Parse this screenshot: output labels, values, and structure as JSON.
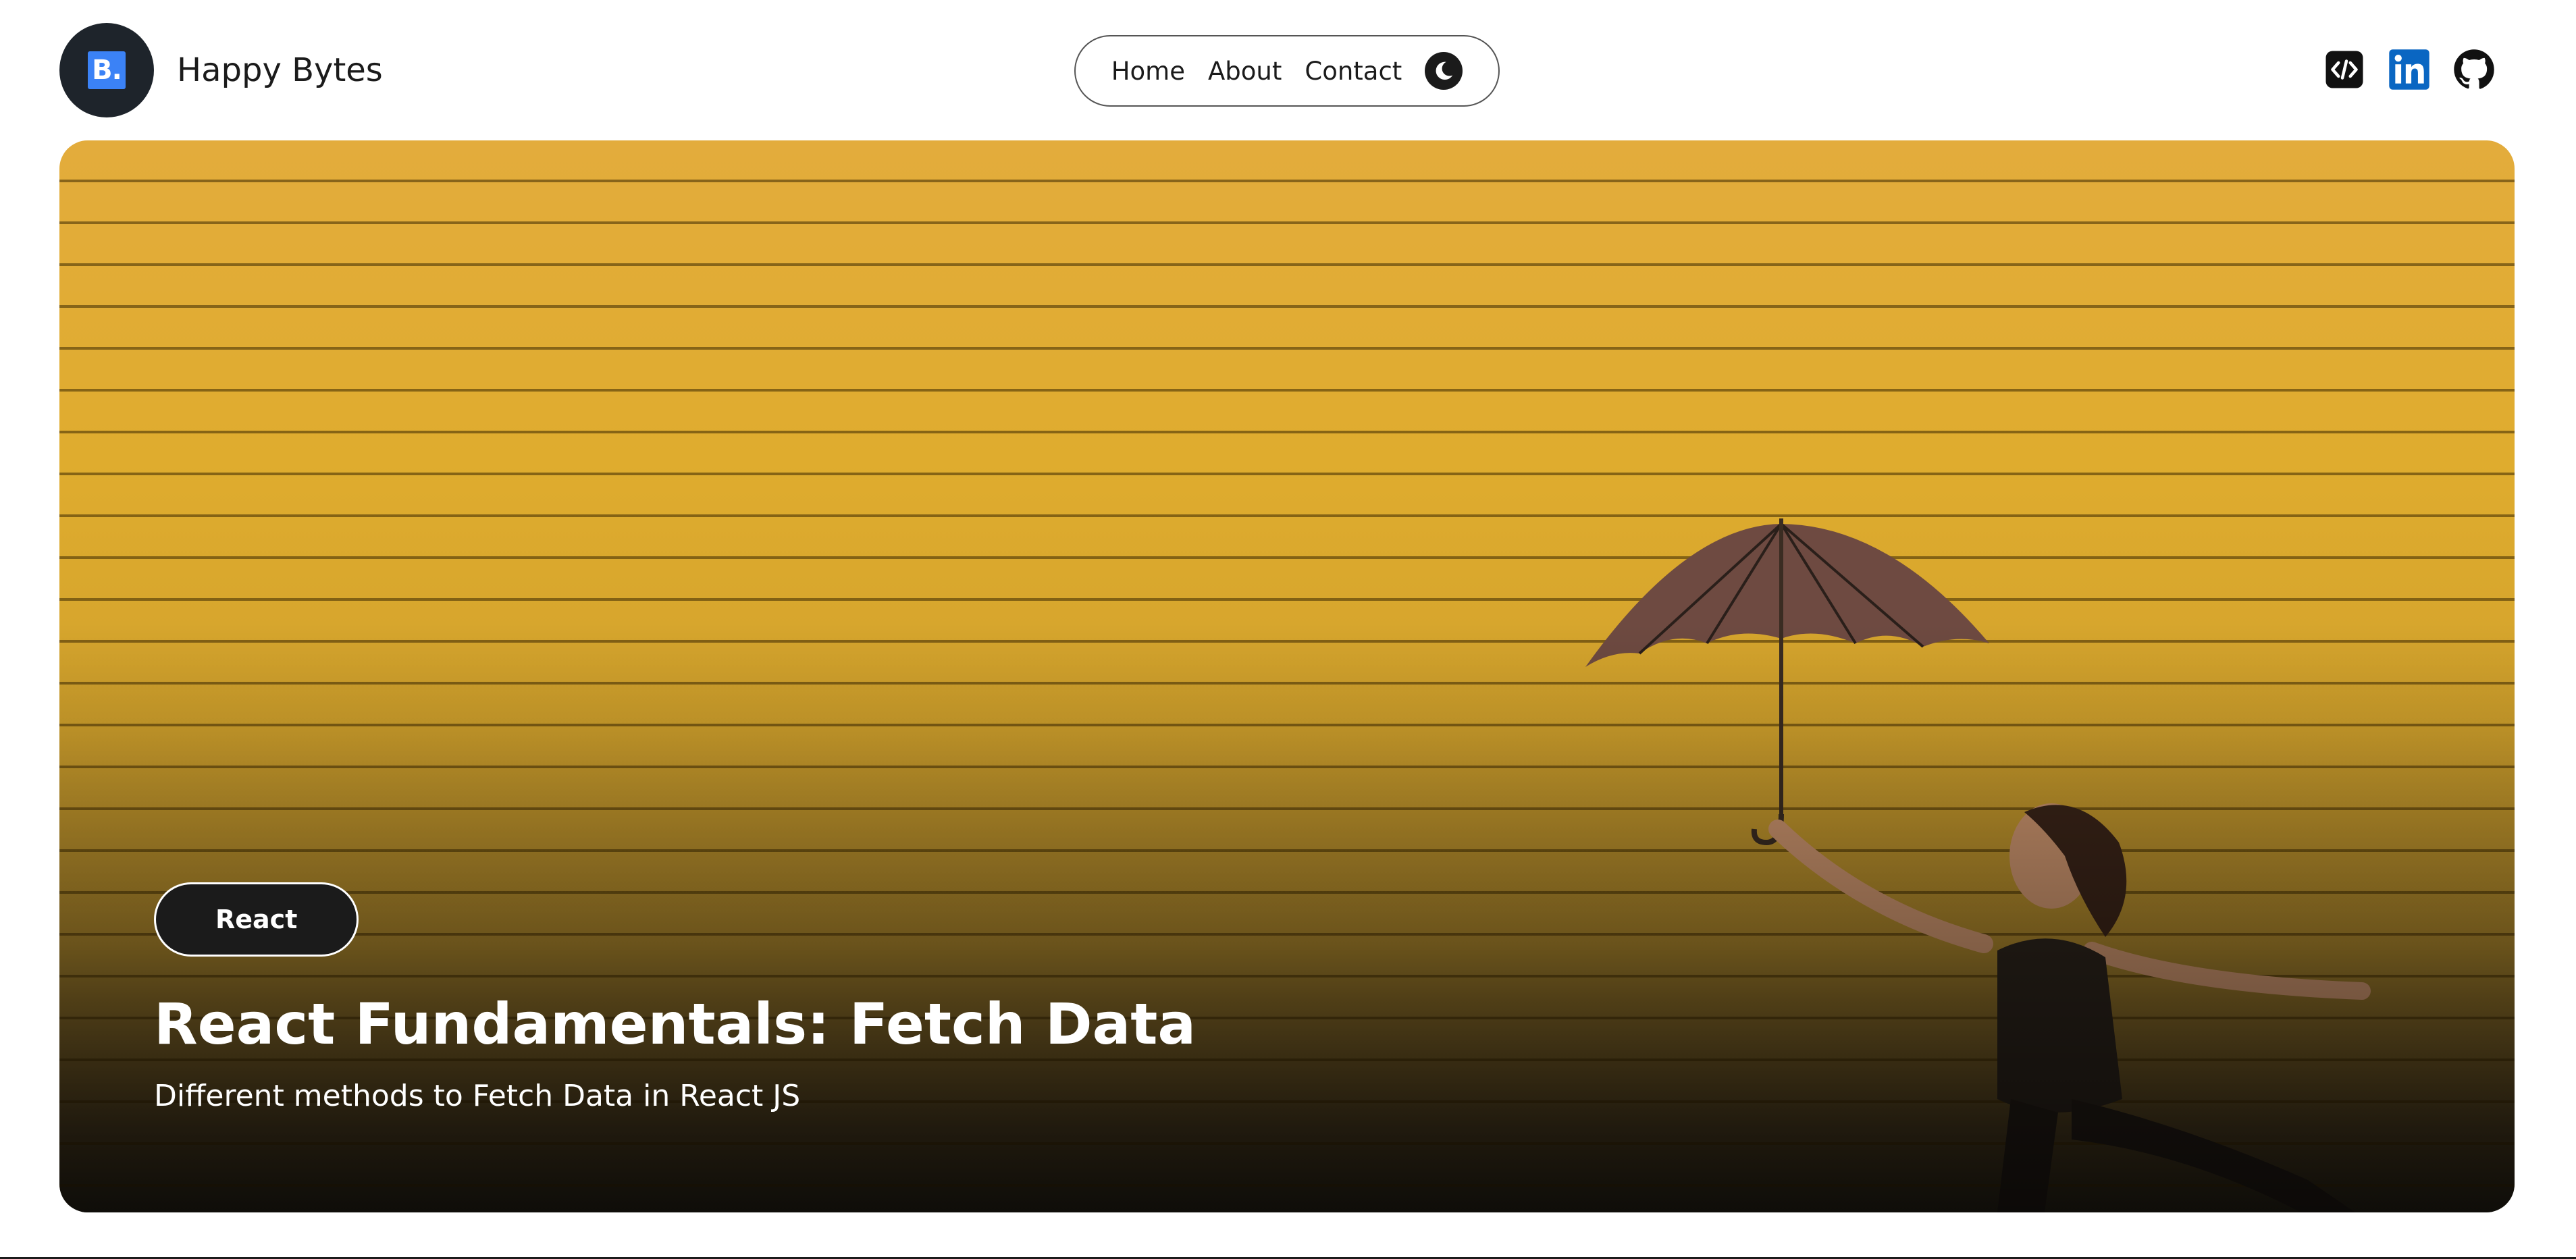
{
  "header": {
    "brand": {
      "logo_text": "B.",
      "name": "Happy Bytes"
    },
    "nav": {
      "items": [
        {
          "label": "Home"
        },
        {
          "label": "About"
        },
        {
          "label": "Contact"
        }
      ],
      "theme_toggle_icon": "moon-icon"
    },
    "socials": [
      {
        "icon": "code-icon"
      },
      {
        "icon": "linkedin-icon"
      },
      {
        "icon": "github-icon"
      }
    ]
  },
  "hero": {
    "tag": "React",
    "title": "React Fundamentals: Fetch Data",
    "subtitle": "Different methods to Fetch Data in React JS",
    "image_colors": {
      "wall": "#dfac2e",
      "umbrella": "#6e4a41",
      "figure": "#2b231b"
    }
  },
  "colors": {
    "dark": "#1b1b1b",
    "logo_bg": "#1e242b",
    "logo_accent": "#3b82f6",
    "linkedin": "#0a66c2"
  }
}
